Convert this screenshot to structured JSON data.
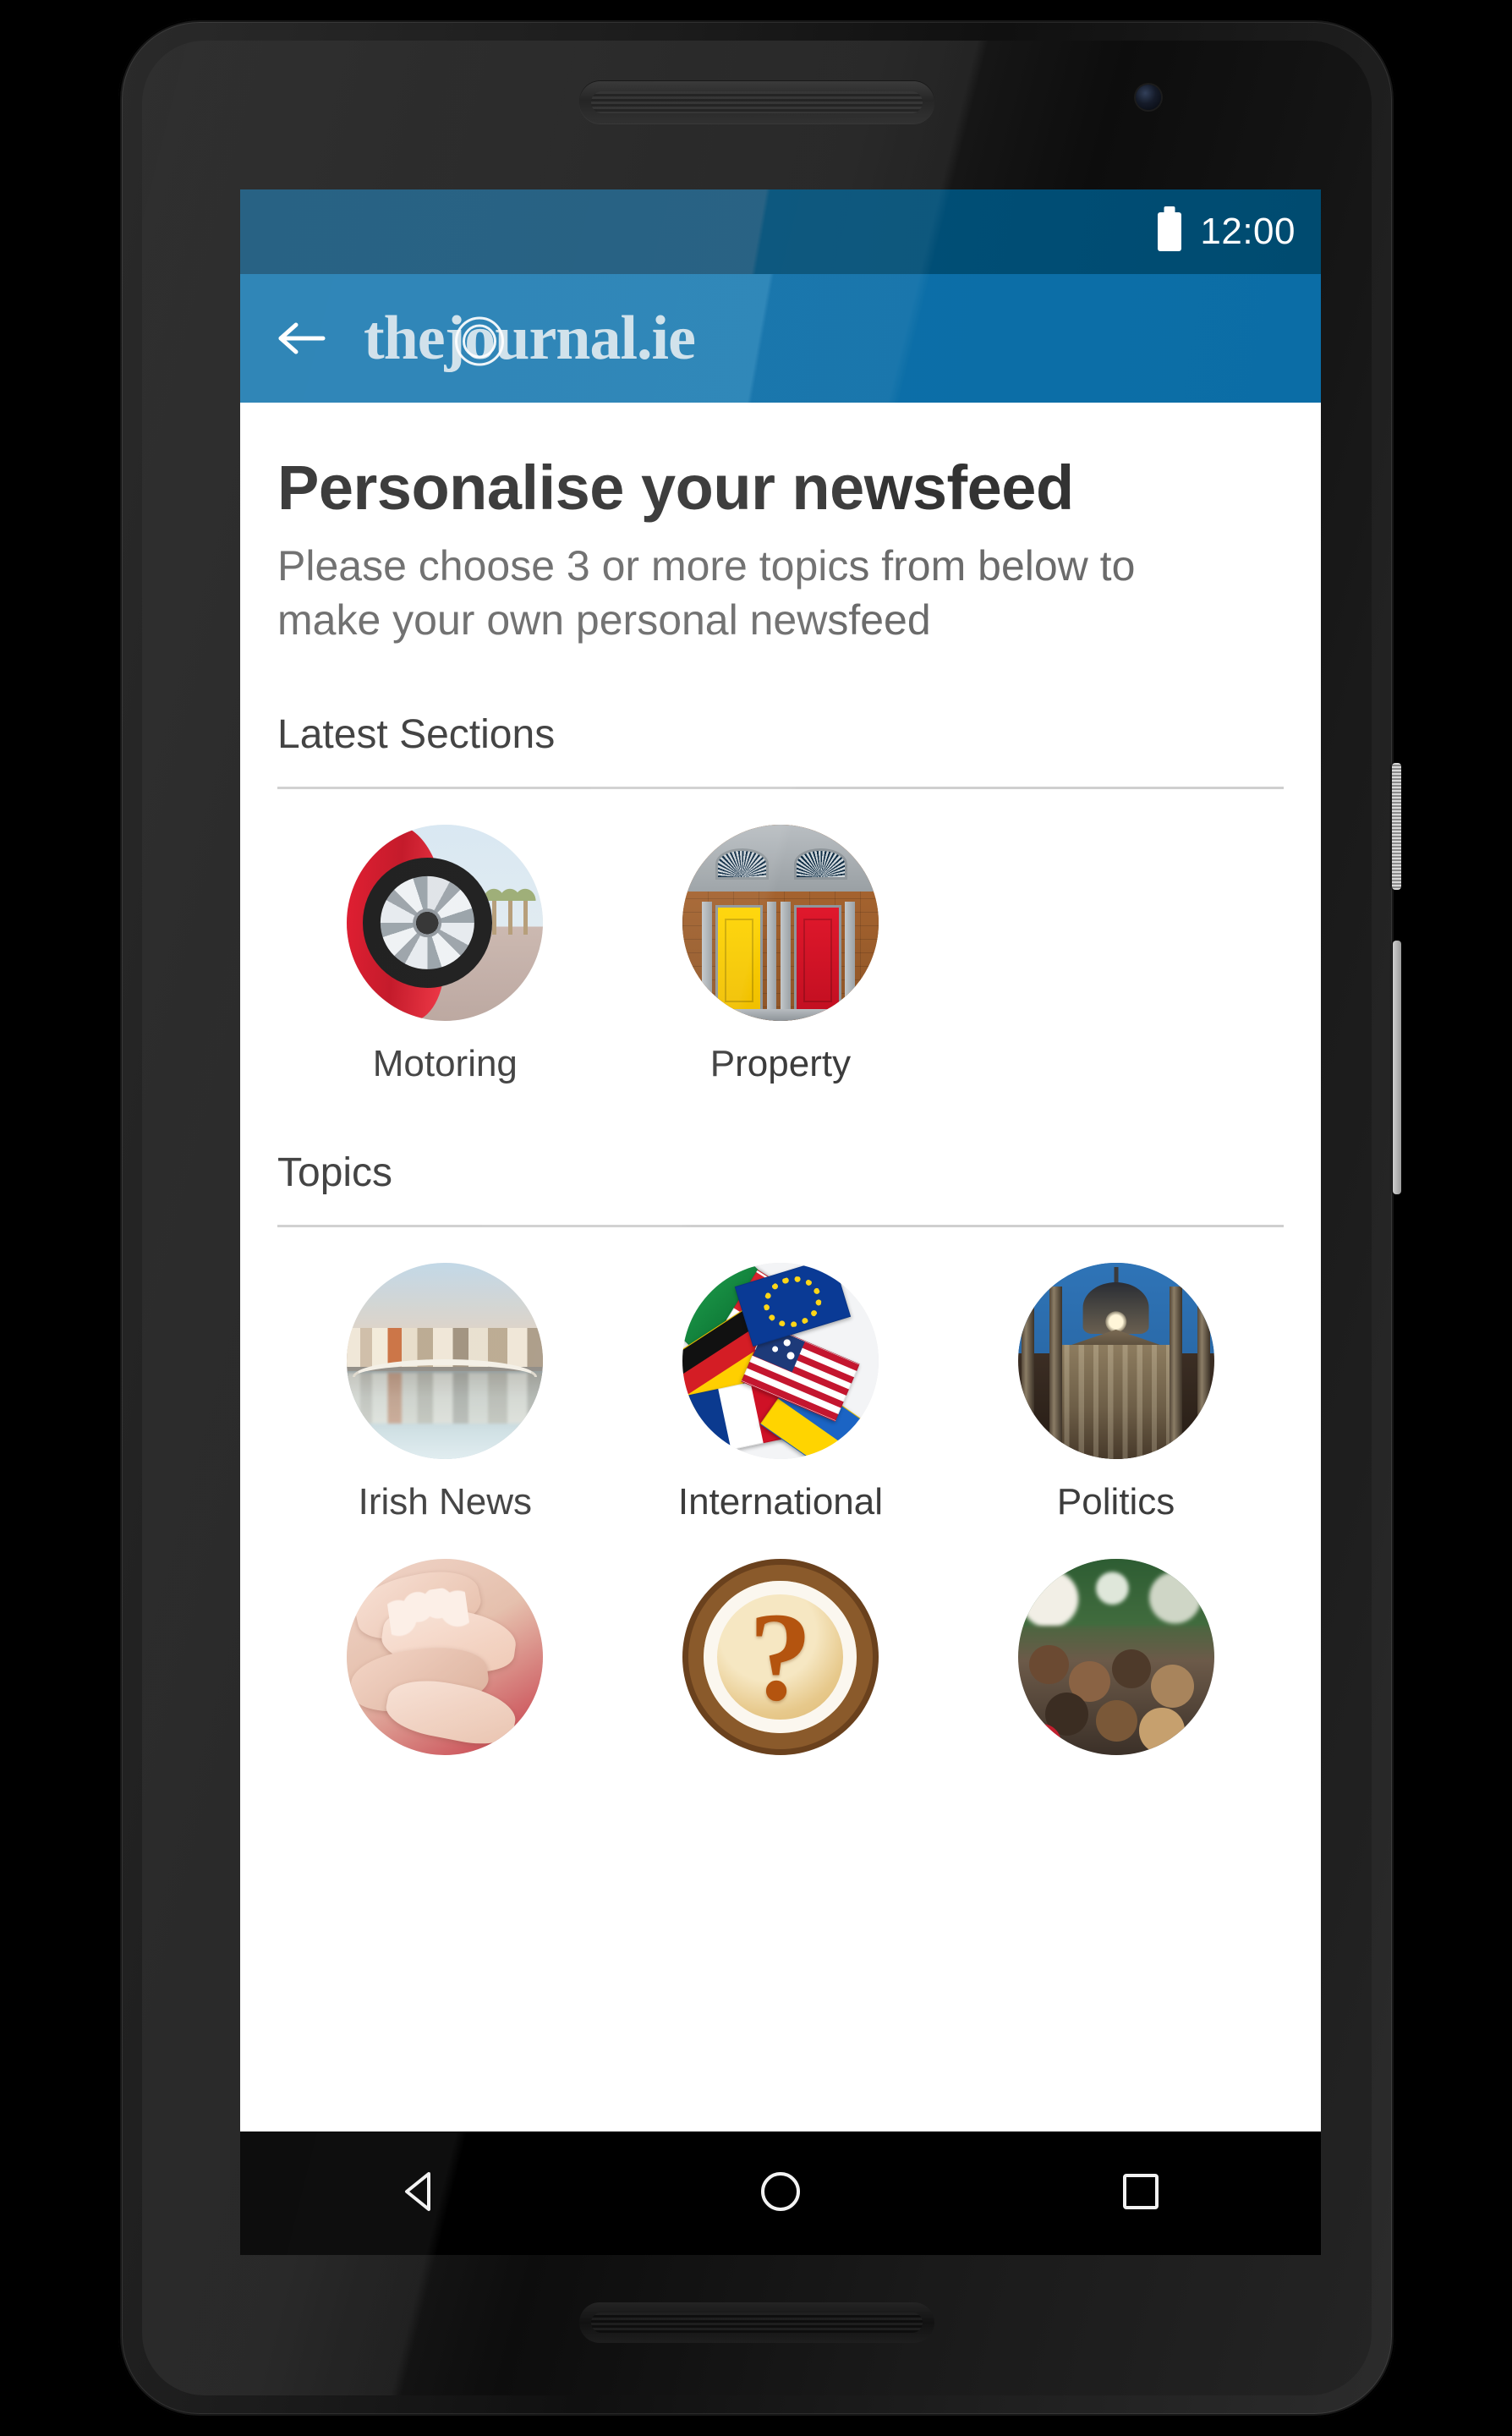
{
  "status_bar": {
    "time": "12:00",
    "battery_icon": "battery-full-icon",
    "background_color": "#004f78"
  },
  "app_bar": {
    "back_icon": "back-arrow-icon",
    "logo_prefix": "thej",
    "logo_swirl_letter": "o",
    "logo_suffix": "urnal.ie",
    "background_color": "#0d6fa8",
    "logo_color": "#cfe0ea"
  },
  "page": {
    "title": "Personalise your newsfeed",
    "subtitle": "Please choose 3 or more topics from below to make your own personal newsfeed",
    "title_color": "#333333",
    "subtitle_color": "#6b6b6b"
  },
  "sections": [
    {
      "heading": "Latest Sections",
      "tiles": [
        {
          "label": "Motoring",
          "thumb": "motoring-thumbnail"
        },
        {
          "label": "Property",
          "thumb": "property-thumbnail"
        }
      ]
    },
    {
      "heading": "Topics",
      "tiles": [
        {
          "label": "Irish News",
          "thumb": "irish-news-thumbnail"
        },
        {
          "label": "International",
          "thumb": "international-thumbnail"
        },
        {
          "label": "Politics",
          "thumb": "politics-thumbnail"
        },
        {
          "label": "",
          "thumb": "hands-thumbnail"
        },
        {
          "label": "",
          "thumb": "coffee-question-thumbnail"
        },
        {
          "label": "",
          "thumb": "crowd-thumbnail"
        }
      ]
    }
  ],
  "nav_bar": {
    "back_icon": "nav-back-triangle-icon",
    "home_icon": "nav-home-circle-icon",
    "recents_icon": "nav-recents-square-icon",
    "background_color": "#000000"
  }
}
